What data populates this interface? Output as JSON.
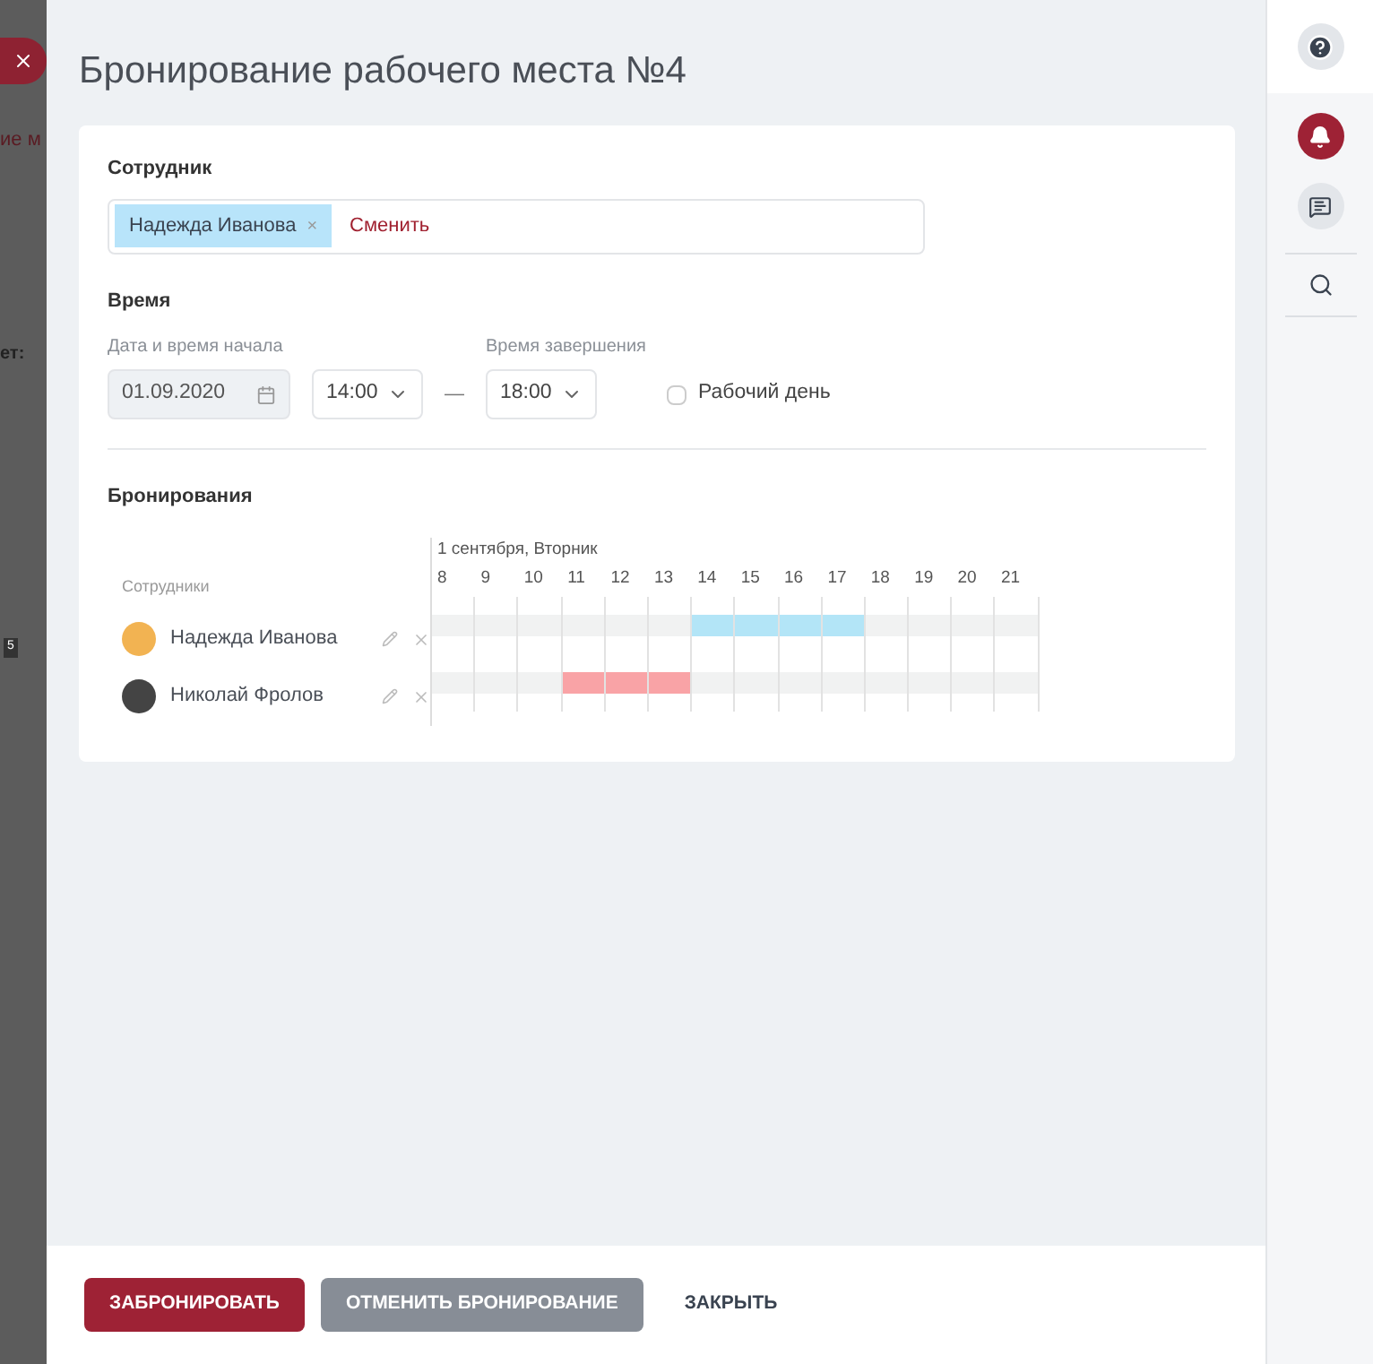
{
  "background": {
    "texts": [
      "ие м",
      "ет:",
      "5"
    ]
  },
  "dialog": {
    "title": "Бронирование рабочего места №4"
  },
  "employee": {
    "label": "Сотрудник",
    "chip": "Надежда Иванова",
    "chip_remove": "×",
    "change_link": "Сменить"
  },
  "time": {
    "label": "Время",
    "start_label": "Дата и время начала",
    "date": "01.09.2020",
    "start_time": "14:00",
    "separator": "—",
    "end_label": "Время завершения",
    "end_time": "18:00",
    "workday": {
      "label": "Рабочий день",
      "checked": false
    }
  },
  "bookings": {
    "label": "Бронирования",
    "people_header": "Сотрудники",
    "date": "1 сентября, Вторник",
    "hours": [
      "8",
      "9",
      "10",
      "11",
      "12",
      "13",
      "14",
      "15",
      "16",
      "17",
      "18",
      "19",
      "20",
      "21"
    ],
    "rows": [
      {
        "name": "Надежда Иванова",
        "color": "#b3e5f7",
        "slots": [
          false,
          false,
          false,
          false,
          false,
          false,
          true,
          true,
          true,
          true,
          false,
          false,
          false,
          false
        ]
      },
      {
        "name": "Николай Фролов",
        "color": "#f9a3a6",
        "slots": [
          false,
          false,
          false,
          true,
          true,
          true,
          false,
          false,
          false,
          false,
          false,
          false,
          false,
          false
        ]
      }
    ]
  },
  "footer": {
    "buttons": [
      {
        "label": "ЗАБРОНИРОВАТЬ",
        "kind": "primary"
      },
      {
        "label": "ОТМЕНИТЬ БРОНИРОВАНИЕ",
        "kind": "secondary"
      },
      {
        "label": "ЗАКРЫТЬ",
        "kind": "text"
      }
    ]
  }
}
